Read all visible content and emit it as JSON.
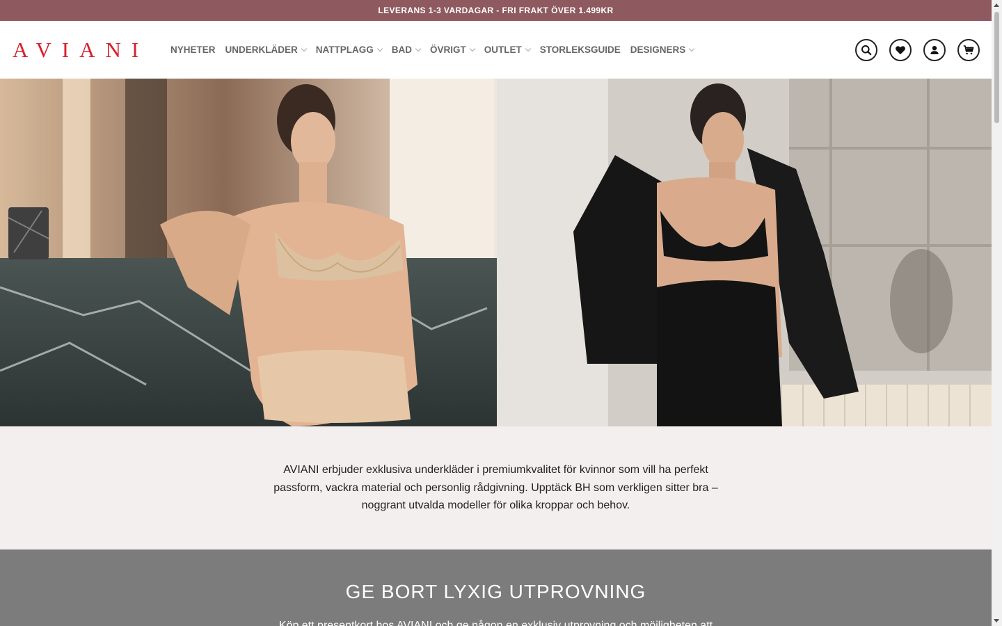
{
  "topbar": {
    "text": "LEVERANS 1-3 VARDAGAR - FRI FRAKT ÖVER 1.499KR"
  },
  "header": {
    "logo": "AVIANI",
    "nav": [
      {
        "label": "NYHETER",
        "has_dropdown": false
      },
      {
        "label": "UNDERKLÄDER",
        "has_dropdown": true
      },
      {
        "label": "NATTPLAGG",
        "has_dropdown": true
      },
      {
        "label": "BAD",
        "has_dropdown": true
      },
      {
        "label": "ÖVRIGT",
        "has_dropdown": true
      },
      {
        "label": "OUTLET",
        "has_dropdown": true
      },
      {
        "label": "STORLEKSGUIDE",
        "has_dropdown": false
      },
      {
        "label": "DESIGNERS",
        "has_dropdown": true
      }
    ],
    "icons": [
      "search-icon",
      "heart-icon",
      "user-icon",
      "cart-icon"
    ]
  },
  "intro": {
    "text": "AVIANI erbjuder exklusiva underkläder i premiumkvalitet för kvinnor som vill ha perfekt passform, vackra material och personlig rådgivning. Upptäck BH som verkligen sitter bra – noggrant utvalda modeller för olika kroppar och behov."
  },
  "gift": {
    "title": "GE BORT LYXIG UTPROVNING",
    "text": "Köp ett presentkort hos AVIANI och ge någon en exklusiv utprovning och möjligheten att"
  },
  "colors": {
    "topbar_bg": "#8e5a5f",
    "logo": "#d8202e",
    "intro_bg": "#f3efee",
    "gift_bg": "#7c7c7c"
  }
}
